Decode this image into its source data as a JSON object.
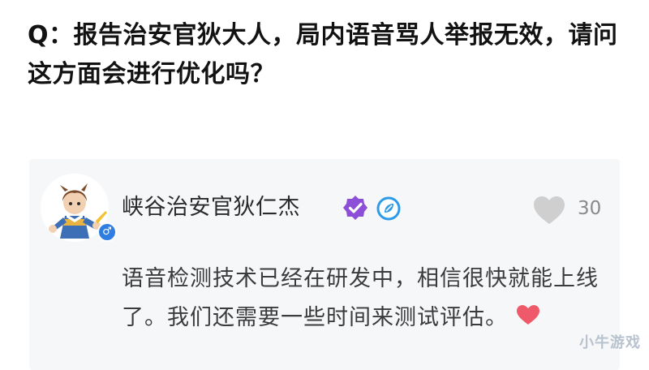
{
  "question": {
    "text": "Q：报告治安官狄大人，局内语音骂人举报无效，请问这方面会进行优化吗？"
  },
  "reply": {
    "author": "峡谷治安官狄仁杰",
    "likes": "30",
    "text": "语音检测技术已经在研发中，相信很快就能上线了。我们还需要一些时间来测试评估",
    "text_tail_punct": "。",
    "icons": {
      "avatar": "character-avatar",
      "gender": "male-gender-icon",
      "verified": "verified-badge-icon",
      "official": "official-account-icon",
      "like": "heart-icon",
      "emoji": "red-heart-icon"
    },
    "gender_symbol": "♂"
  },
  "watermark": {
    "text": "小牛游戏"
  },
  "colors": {
    "card_bg": "#f6f7f8",
    "verified_purple": "#8e4fd8",
    "official_blue": "#2d9be8",
    "like_gray": "#cfcfcf",
    "heart_red": "#ef5a6a",
    "gender_blue": "#2f7de1"
  }
}
